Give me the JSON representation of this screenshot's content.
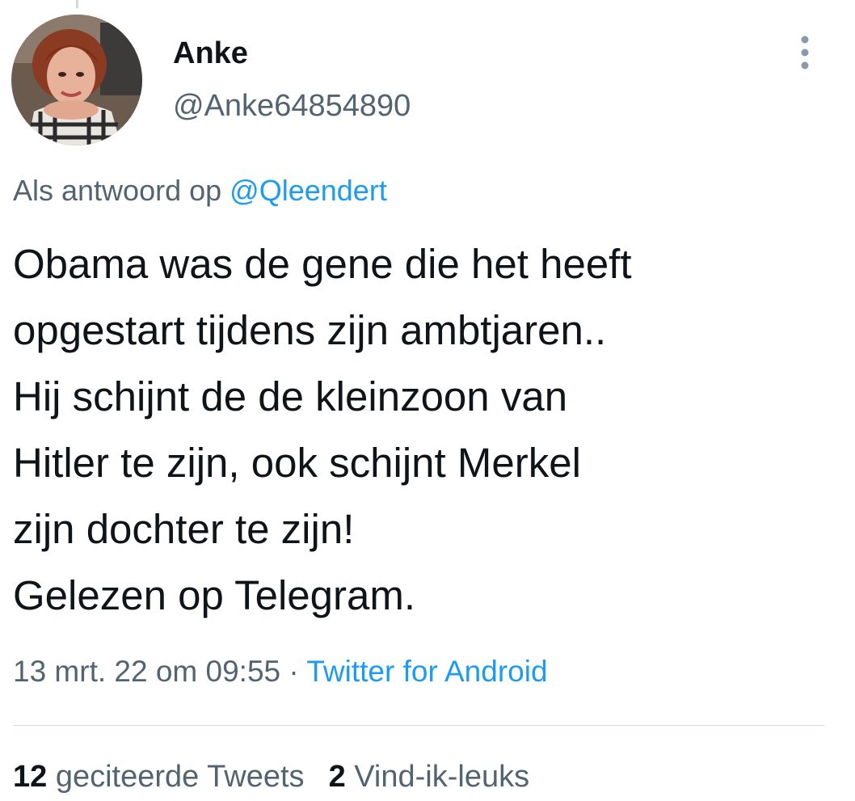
{
  "author": {
    "display_name": "Anke",
    "handle": "@Anke64854890"
  },
  "reply_context": {
    "prefix": "Als antwoord op",
    "mention": "@Qleendert"
  },
  "tweet": {
    "text": "Obama was de gene die het heeft\nopgestart tijdens zijn ambtjaren..\nHij schijnt de de kleinzoon van\nHitler te zijn, ook schijnt Merkel\nzijn dochter te zijn!\nGelezen op Telegram."
  },
  "meta": {
    "timestamp": "13 mrt. 22 om 09:55",
    "separator": " · ",
    "source": "Twitter for Android"
  },
  "stats": {
    "quote_count": "12",
    "quote_label": "geciteerde Tweets",
    "like_count": "2",
    "like_label": "Vind-ik-leuks"
  },
  "icons": {
    "more": "more-vertical-icon"
  },
  "colors": {
    "text": "#0f1419",
    "secondary": "#536471",
    "link": "#1d9bf0",
    "divider": "#cfd9de"
  }
}
